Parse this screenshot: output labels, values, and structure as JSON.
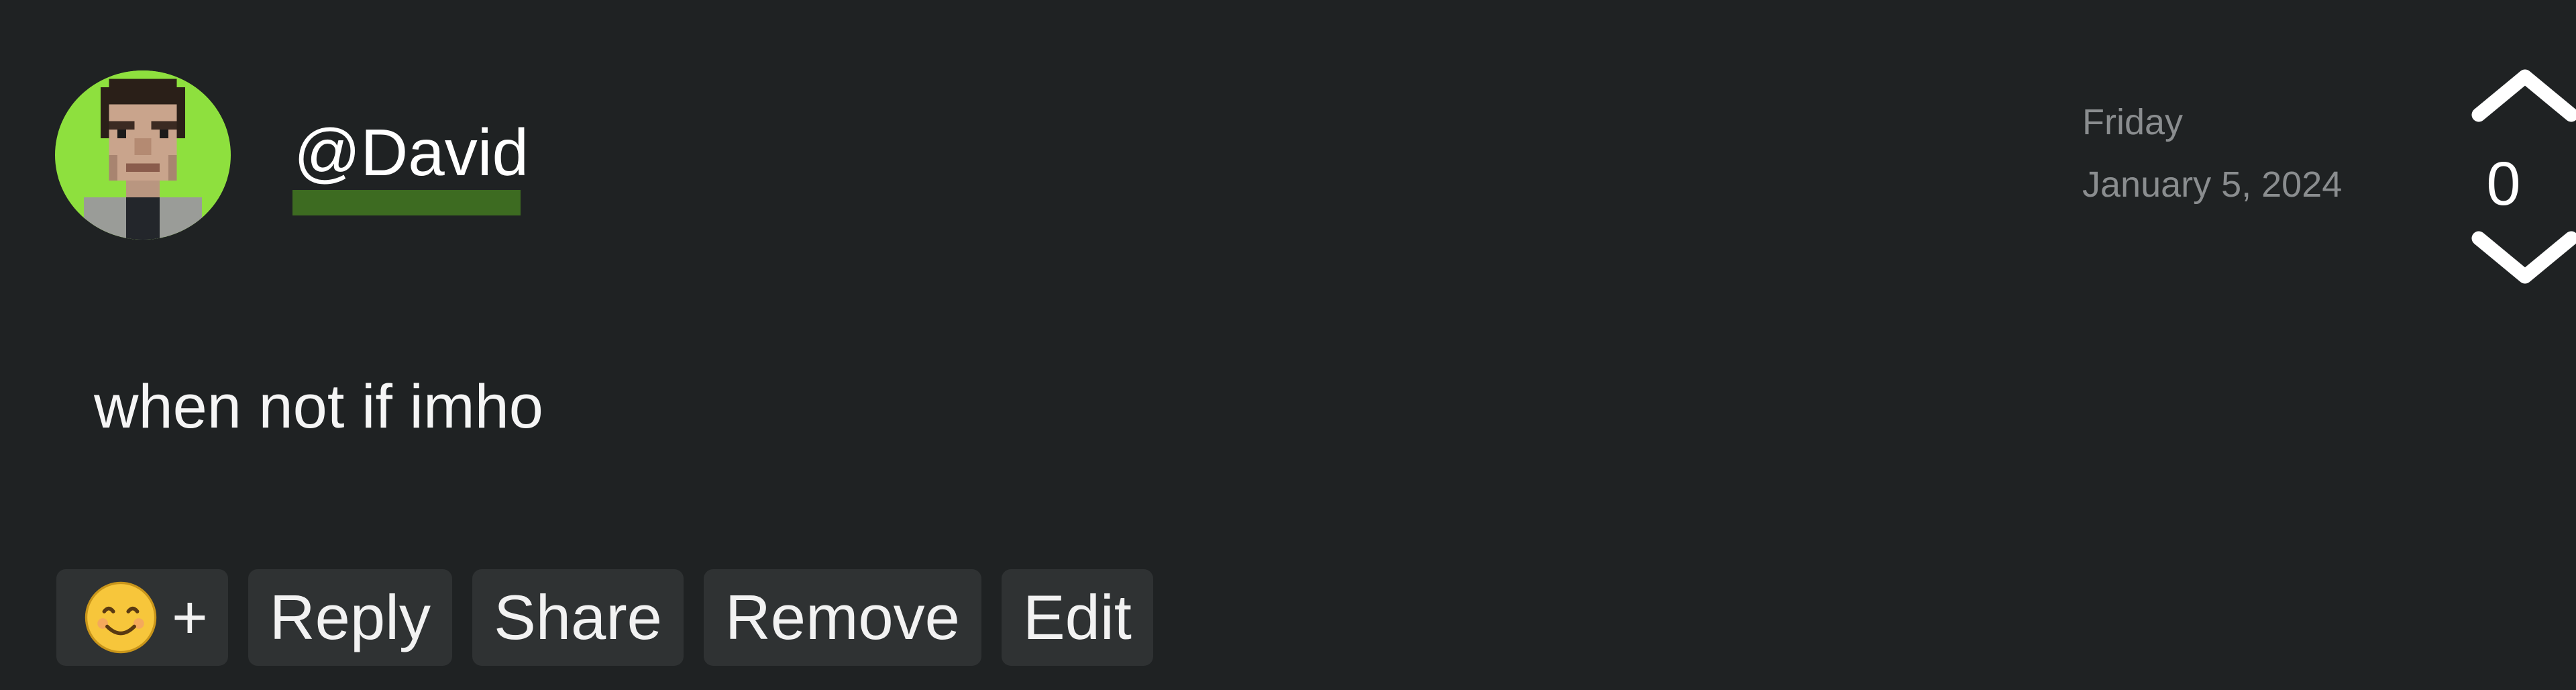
{
  "comment": {
    "username": "@David",
    "date_day": "Friday",
    "date_full": "January 5, 2024",
    "vote_count": "0",
    "body": "when not if imho"
  },
  "actions": {
    "emoji_plus": "+",
    "reply": "Reply",
    "share": "Share",
    "remove": "Remove",
    "edit": "Edit"
  },
  "icons": {
    "avatar": "pixel-portrait-avatar",
    "upvote": "chevron-up-icon",
    "downvote": "chevron-down-icon",
    "emoji": "smiling-face-emoji-icon"
  },
  "colors": {
    "background": "#1f2223",
    "button_bg": "#2f3233",
    "username_highlight": "#3d6b21",
    "avatar_bg": "#8ee03e",
    "muted_text": "#8a8d8f"
  }
}
